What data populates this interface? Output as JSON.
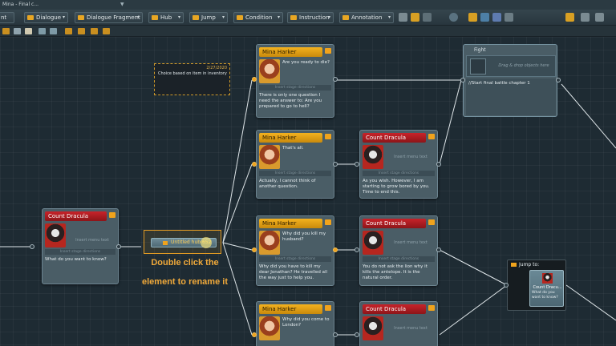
{
  "window": {
    "title": "Mina - Final c..."
  },
  "toolbar": {
    "items": [
      {
        "label": "nt"
      },
      {
        "label": "Dialogue"
      },
      {
        "label": "Dialogue Fragment"
      },
      {
        "label": "Hub"
      },
      {
        "label": "Jump"
      },
      {
        "label": "Condition"
      },
      {
        "label": "Instruction"
      },
      {
        "label": "Annotation"
      }
    ]
  },
  "canvas": {
    "comment": {
      "date": "2/27/2020",
      "text": "Choice based on item in inventory"
    },
    "start_node": {
      "speaker": "Count Dracula",
      "menu_placeholder": "Insert menu text",
      "stage_placeholder": "Insert stage directions",
      "text": "What do you want to know?"
    },
    "hub": {
      "label": "Untitled hub 652"
    },
    "caption": {
      "line1": "Double click the",
      "line2": "element to rename it"
    },
    "nodes": [
      {
        "speaker": "Mina Harker",
        "menu": "Are you ready to die?",
        "stage": "Insert stage directions",
        "text": "There is only one question I need the answer to: Are you prepared to go to hell?"
      },
      {
        "speaker": "Mina Harker",
        "menu": "That's all.",
        "stage": "Insert stage directions",
        "text": "Actually, I cannot think of another question."
      },
      {
        "speaker": "Count Dracula",
        "menu": "Insert menu text",
        "stage": "Insert stage directions",
        "text": "As you wish. However, I am starting to grow bored by you. Time to end this."
      },
      {
        "speaker": "Mina Harker",
        "menu": "Why did you kill my husband?",
        "stage": "Insert stage directions",
        "text": "Why did you have to kill my dear Jonathan? He travelled all the way just to help you."
      },
      {
        "speaker": "Count Dracula",
        "menu": "Insert menu text",
        "stage": "Insert stage directions",
        "text": "You do not ask the lion why it kills the antelope. It is the natural order."
      },
      {
        "speaker": "Mina Harker",
        "menu": "Why did you come to London?",
        "stage": "",
        "text": ""
      },
      {
        "speaker": "Count Dracula",
        "menu": "Insert menu text",
        "stage": "",
        "text": ""
      }
    ],
    "fight": {
      "title": "Fight",
      "drop_hint": "Drag & drop objects here",
      "text": "//Start final battle chapter 1"
    },
    "jump": {
      "title": "Jump to:",
      "target_name": "Count Dracu...",
      "target_text": "What do you want to know?"
    }
  },
  "colors": {
    "accent": "#f0a31c",
    "mina_header": "#f3b21f",
    "dracula_header": "#c8232a",
    "canvas": "#1e2b33"
  }
}
